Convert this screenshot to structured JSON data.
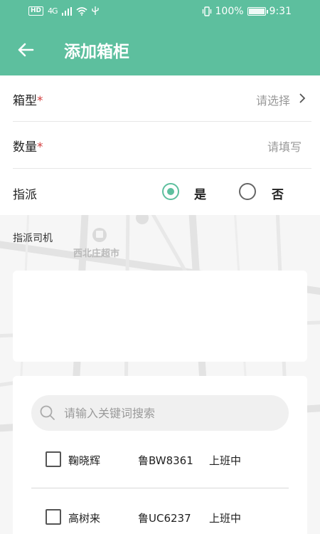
{
  "status_bar": {
    "hd": "HD",
    "network": "4G",
    "battery_text": "100%",
    "battery_level": 1.0,
    "time": "9:31"
  },
  "header": {
    "title": "添加箱柜",
    "back_icon": "arrow-left-icon",
    "bg_color": "#5dbf9e"
  },
  "form": {
    "box_type": {
      "label": "箱型",
      "required_mark": "*",
      "placeholder": "请选择"
    },
    "quantity": {
      "label": "数量",
      "required_mark": "*",
      "placeholder": "请填写"
    },
    "assign": {
      "label": "指派",
      "options": [
        {
          "label": "是",
          "selected": true
        },
        {
          "label": "否",
          "selected": false
        }
      ]
    }
  },
  "map": {
    "poi_label": "西北庄超市"
  },
  "driver_section": {
    "label": "指派司机",
    "search_placeholder": "请输入关键词搜索",
    "drivers": [
      {
        "name": "鞠晓辉",
        "plate": "鲁BW8361",
        "status": "上班中",
        "checked": false
      },
      {
        "name": "高树来",
        "plate": "鲁UC6237",
        "status": "上班中",
        "checked": false
      }
    ]
  },
  "colors": {
    "accent": "#5dbf9e",
    "required": "#d23c3c"
  }
}
